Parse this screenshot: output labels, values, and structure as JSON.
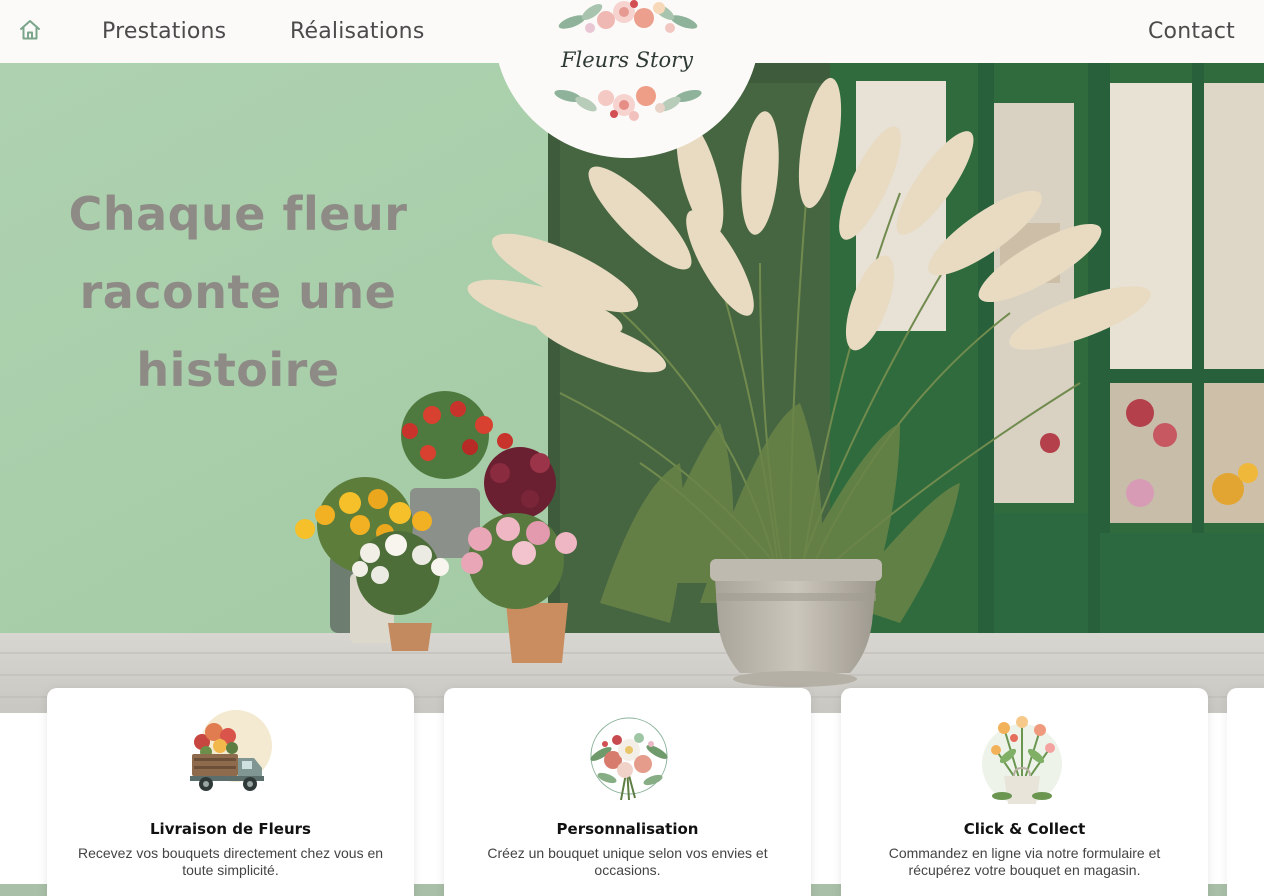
{
  "nav": {
    "home_icon": "home-icon",
    "items": [
      {
        "label": "Prestations"
      },
      {
        "label": "Réalisations"
      }
    ],
    "contact_label": "Contact"
  },
  "logo": {
    "text": "Fleurs Story"
  },
  "hero": {
    "title_lines": [
      "Chaque fleur",
      "raconte une",
      "histoire"
    ]
  },
  "services": [
    {
      "icon": "delivery-truck-icon",
      "title": "Livraison de Fleurs",
      "description": "Recevez vos bouquets directement chez vous en toute simplicité."
    },
    {
      "icon": "bouquet-icon",
      "title": "Personnalisation",
      "description": "Créez un bouquet unique selon vos envies et occasions."
    },
    {
      "icon": "flower-bag-icon",
      "title": "Click & Collect",
      "description": "Commandez en ligne via notre formulaire et récupérez votre bouquet en magasin."
    }
  ],
  "colors": {
    "wall": "#a7cda9",
    "door_green": "#2f6b3d",
    "band_strip": "#a9bfa7",
    "title_gray": "#8e8a86"
  }
}
